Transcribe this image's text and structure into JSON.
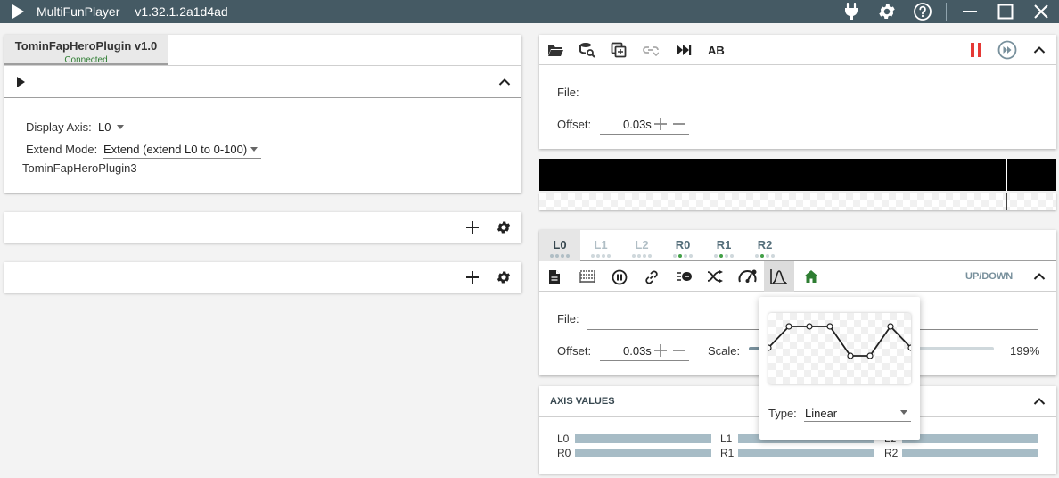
{
  "titlebar": {
    "app_name": "MultiFunPlayer",
    "version": "v1.32.1.2a1d4ad",
    "icons": [
      "play-icon",
      "plug-icon",
      "settings-gear-icon",
      "help-icon",
      "minimize-icon",
      "maximize-icon",
      "close-icon"
    ]
  },
  "plugin": {
    "tab_title": "TominFapHeroPlugin v1.0",
    "tab_status": "Connected",
    "display_axis_label": "Display Axis:",
    "display_axis_value": "L0",
    "extend_mode_label": "Extend Mode:",
    "extend_mode_value": "Extend (extend L0 to 0-100)",
    "instance_name": "TominFapHeroPlugin3"
  },
  "media": {
    "toolbar_icons": [
      "folder-open-icon",
      "search-database-icon",
      "copy-icon",
      "link-arrow-icon",
      "skip-next-icon"
    ],
    "ab_label": "AB",
    "file_label": "File:",
    "file_value": "",
    "offset_label": "Offset:",
    "offset_value": "0.03s"
  },
  "axes": {
    "tabs": [
      {
        "label": "L0",
        "active": true,
        "dots": [
          0,
          0,
          0,
          0
        ]
      },
      {
        "label": "L1",
        "active": false,
        "dots": [
          0,
          0,
          0,
          0
        ]
      },
      {
        "label": "L2",
        "active": false,
        "dots": [
          0,
          0,
          0,
          0
        ]
      },
      {
        "label": "R0",
        "active": false,
        "dots": [
          0,
          1,
          0,
          0
        ]
      },
      {
        "label": "R1",
        "active": false,
        "dots": [
          0,
          1,
          0,
          0
        ]
      },
      {
        "label": "R2",
        "active": false,
        "dots": [
          0,
          1,
          0,
          0
        ]
      }
    ],
    "toolbar_icons": [
      "file-icon",
      "sync-gap-icon",
      "pause-circle-icon",
      "link-icon",
      "speed-limit-icon",
      "motion-path-icon",
      "speedometer-icon",
      "interpolation-curve-icon",
      "home-icon"
    ],
    "motion_label": "UP/DOWN",
    "file_label": "File:",
    "offset_label": "Offset:",
    "offset_value": "0.03s",
    "scale_label": "Scale:",
    "scale_value": "199%"
  },
  "axis_values": {
    "title": "AXIS VALUES",
    "labels": [
      "L0",
      "L1",
      "L2",
      "R0",
      "R1",
      "R2"
    ]
  },
  "interpolation_popup": {
    "type_label": "Type:",
    "type_value": "Linear"
  },
  "colors": {
    "titlebar": "#455a64",
    "connected": "#2e7d32",
    "pause_red": "#e53935",
    "home_green": "#2e7d32",
    "bar": "#a7bcc6"
  }
}
